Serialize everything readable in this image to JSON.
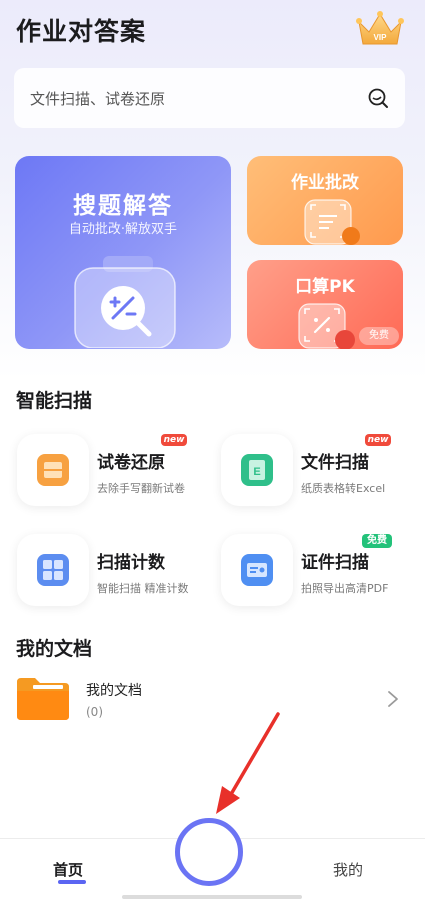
{
  "header": {
    "title": "作业对答案",
    "vip_label": "VIP"
  },
  "search": {
    "placeholder": "文件扫描、试卷还原"
  },
  "cards": {
    "main": {
      "title": "搜题解答",
      "subtitle": "自动批改·解放双手"
    },
    "homework": {
      "title": "作业批改"
    },
    "pk": {
      "title": "口算PK",
      "badge": "免费"
    }
  },
  "smart_scan": {
    "title": "智能扫描",
    "tools": [
      {
        "name": "试卷还原",
        "desc": "去除手写翻新试卷",
        "badge": "new"
      },
      {
        "name": "文件扫描",
        "desc": "纸质表格转Excel",
        "badge": "new"
      },
      {
        "name": "扫描计数",
        "desc": "智能扫描 精准计数",
        "badge": ""
      },
      {
        "name": "证件扫描",
        "desc": "拍照导出高清PDF",
        "badge": "免费"
      }
    ]
  },
  "my_docs": {
    "title": "我的文档",
    "item": {
      "name": "我的文档",
      "count": "(0)"
    }
  },
  "tabbar": {
    "home": "首页",
    "me": "我的"
  },
  "colors": {
    "accent": "#5b65f2",
    "orange": "#ff9a4e",
    "red": "#ff6a56",
    "green": "#23c27a"
  }
}
